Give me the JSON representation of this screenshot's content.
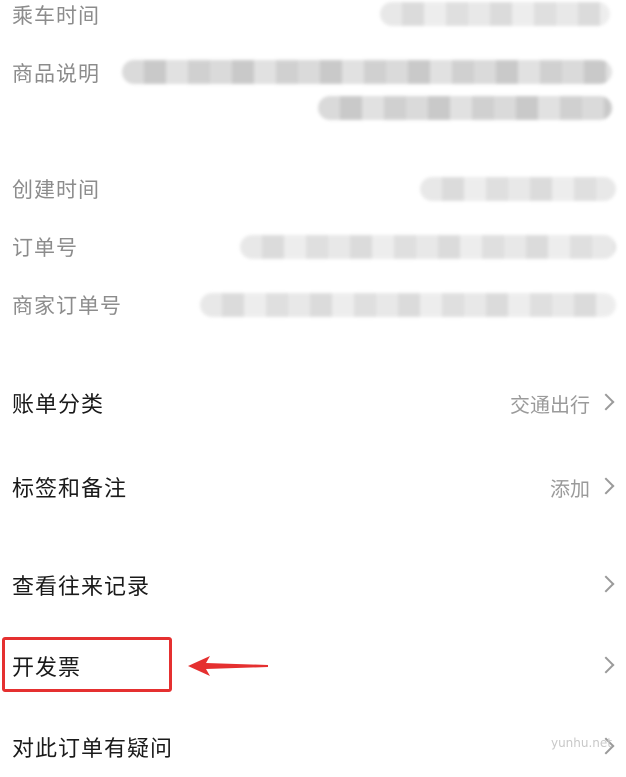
{
  "details": {
    "ride_time_label": "乘车时间",
    "product_desc_label": "商品说明",
    "created_time_label": "创建时间",
    "order_no_label": "订单号",
    "merchant_order_no_label": "商家订单号"
  },
  "menu": {
    "bill_category": {
      "label": "账单分类",
      "value": "交通出行"
    },
    "tags_notes": {
      "label": "标签和备注",
      "value": "添加"
    },
    "history": {
      "label": "查看往来记录"
    },
    "invoice": {
      "label": "开发票"
    },
    "question": {
      "label": "对此订单有疑问"
    }
  },
  "colors": {
    "highlight": "#e53030",
    "label_muted": "#8c8c8c",
    "text_primary": "#1a1a1a"
  },
  "watermark": "yunhu.net"
}
